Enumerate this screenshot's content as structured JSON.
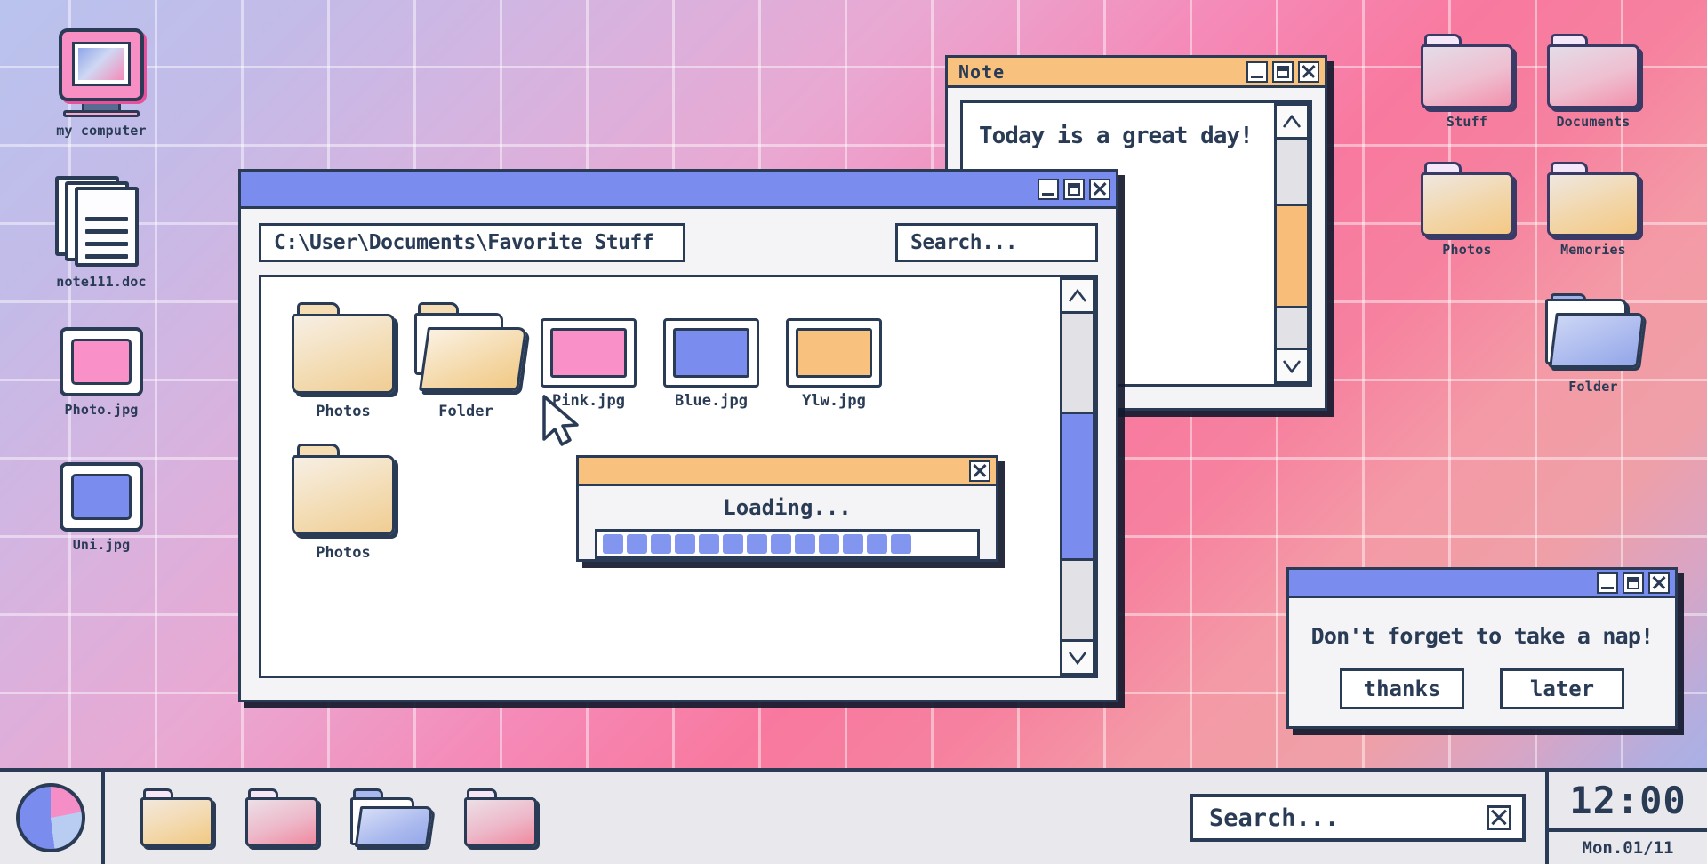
{
  "desktop": {
    "icons": [
      {
        "label": "my computer",
        "type": "computer-icon"
      },
      {
        "label": "note111.doc",
        "type": "document-stack-icon"
      },
      {
        "label": "Photo.jpg",
        "type": "image-icon",
        "color": "#f991c8"
      },
      {
        "label": "Uni.jpg",
        "type": "image-icon",
        "color": "#7b8cef"
      }
    ],
    "right_icons": [
      {
        "label": "Stuff",
        "type": "folder-pink-icon"
      },
      {
        "label": "Documents",
        "type": "folder-pink-icon"
      },
      {
        "label": "Photos",
        "type": "folder-tan-icon"
      },
      {
        "label": "Memories",
        "type": "folder-tan-icon"
      },
      {
        "label": "Folder",
        "type": "folder-open-blue-icon"
      }
    ]
  },
  "explorer": {
    "path_value": "C:\\User\\Documents\\Favorite Stuff",
    "search_placeholder": "Search...",
    "window_buttons": {
      "minimize": "minimize-icon",
      "maximize": "maximize-icon",
      "close": "close-icon"
    },
    "files": [
      {
        "name": "Photos",
        "type": "folder"
      },
      {
        "name": "Folder",
        "type": "folder-open"
      },
      {
        "name": "Pink.jpg",
        "type": "image",
        "color": "#f991c8"
      },
      {
        "name": "Blue.jpg",
        "type": "image",
        "color": "#7b8cef"
      },
      {
        "name": "Ylw.jpg",
        "type": "image",
        "color": "#f8c27e"
      },
      {
        "name": "Photos",
        "type": "folder"
      }
    ],
    "scrollbar": {
      "up": "chevron-up-icon",
      "down": "chevron-down-icon",
      "thumb_color": "#7b8cef"
    }
  },
  "note": {
    "title": "Note",
    "body_text": "Today is a great day!",
    "scrollbar": {
      "thumb_color": "#f8bd78"
    }
  },
  "loading": {
    "title": "",
    "label": "Loading...",
    "blocks": 13,
    "block_color": "#8296ef"
  },
  "nap": {
    "message": "Don't forget to take a nap!",
    "buttons": [
      "thanks",
      "later"
    ]
  },
  "taskbar": {
    "start": "pie-chart-icon",
    "items": [
      {
        "type": "folder-tan-icon"
      },
      {
        "type": "folder-pink-icon"
      },
      {
        "type": "folder-open-blue-icon"
      },
      {
        "type": "folder-pink-icon"
      }
    ],
    "search_placeholder": "Search...",
    "clock_time": "12:00",
    "clock_date": "Mon.01/11"
  },
  "colors": {
    "ink": "#2a3b56",
    "blue_title": "#7b8cef",
    "orange_title": "#f8c27e",
    "pink": "#f991c8"
  }
}
